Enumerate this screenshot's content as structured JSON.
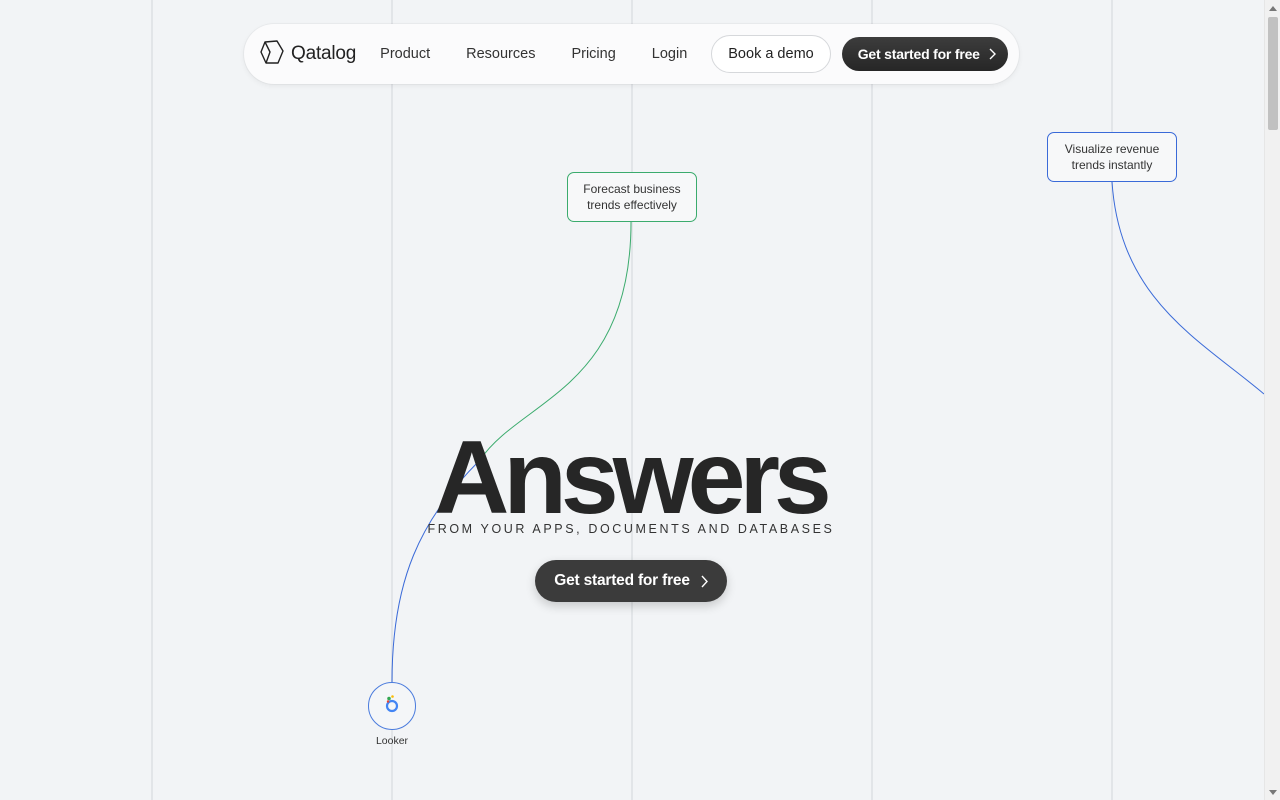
{
  "navbar": {
    "brand": "Qatalog",
    "links": [
      "Product",
      "Resources",
      "Pricing",
      "Login"
    ],
    "demo_label": "Book a demo",
    "cta_label": "Get started for free"
  },
  "tooltips": {
    "green": "Forecast business trends effectively",
    "blue": "Visualize revenue trends instantly"
  },
  "hero": {
    "title": "Answers",
    "subtitle": "FROM YOUR APPS, DOCUMENTS AND DATABASES",
    "cta_label": "Get started for free"
  },
  "integration": {
    "label": "Looker",
    "icon": "looker-icon"
  },
  "colors": {
    "background": "#f2f4f6",
    "accent_green": "#3bab6d",
    "accent_blue": "#3a6ad8",
    "cta": "#262626"
  }
}
